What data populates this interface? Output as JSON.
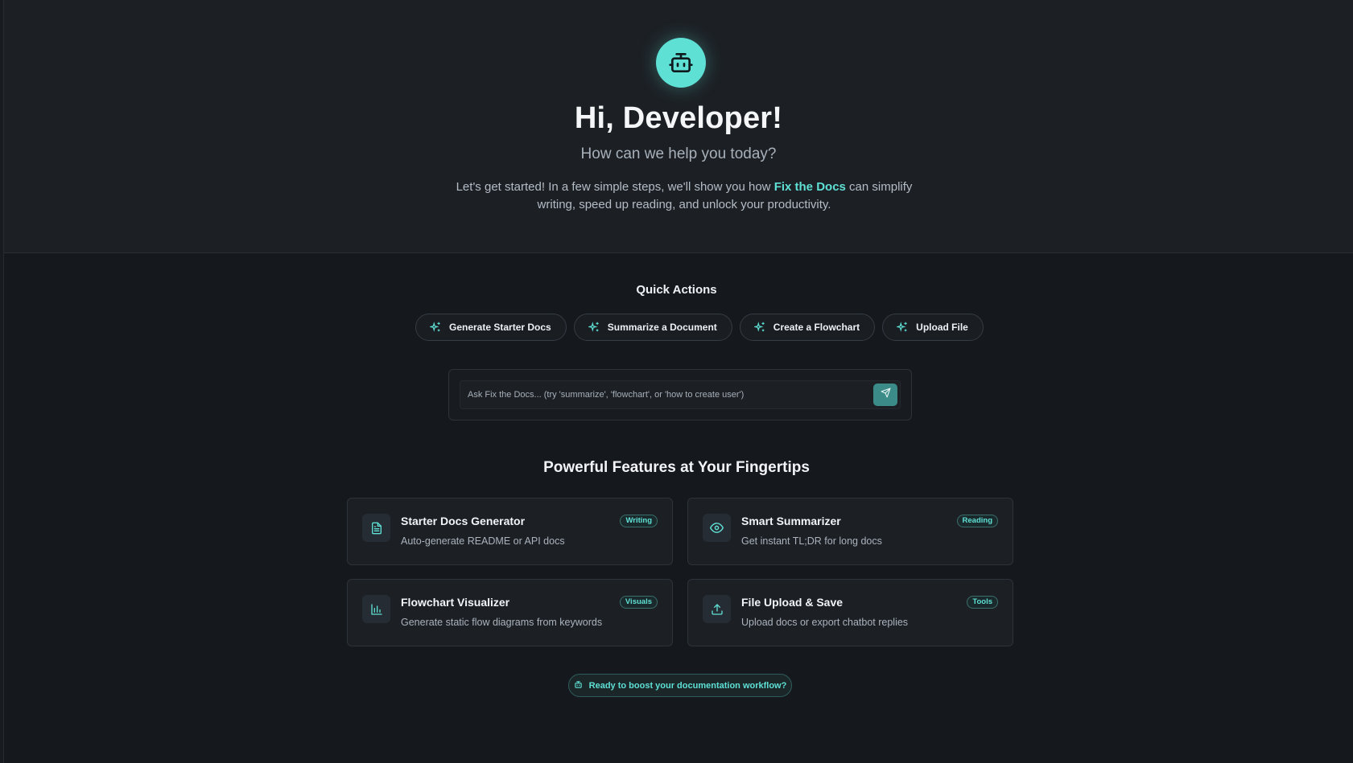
{
  "hero": {
    "title": "Hi, Developer!",
    "subtitle": "How can we help you today?",
    "description_before": "Let's get started! In a few simple steps, we'll show you how ",
    "brand": "Fix the Docs",
    "description_after": " can simplify writing, speed up reading, and unlock your productivity."
  },
  "quick_actions": {
    "title": "Quick Actions",
    "items": [
      {
        "label": "Generate Starter Docs",
        "icon": "sparkle-icon"
      },
      {
        "label": "Summarize a Document",
        "icon": "sparkle-icon"
      },
      {
        "label": "Create a Flowchart",
        "icon": "sparkle-icon"
      },
      {
        "label": "Upload File",
        "icon": "sparkle-icon"
      }
    ]
  },
  "ask": {
    "placeholder": "Ask Fix the Docs... (try 'summarize', 'flowchart', or 'how to create user')",
    "value": ""
  },
  "features": {
    "title": "Powerful Features at Your Fingertips",
    "items": [
      {
        "title": "Starter Docs Generator",
        "description": "Auto-generate README or API docs",
        "badge": "Writing",
        "icon": "document-icon"
      },
      {
        "title": "Smart Summarizer",
        "description": "Get instant TL;DR for long docs",
        "badge": "Reading",
        "icon": "eye-icon"
      },
      {
        "title": "Flowchart Visualizer",
        "description": "Generate static flow diagrams from keywords",
        "badge": "Visuals",
        "icon": "bar-chart-icon"
      },
      {
        "title": "File Upload & Save",
        "description": "Upload docs or export chatbot replies",
        "badge": "Tools",
        "icon": "upload-icon"
      }
    ]
  },
  "cta": {
    "label": "Ready to boost your documentation workflow?"
  },
  "colors": {
    "accent": "#5fe0d5",
    "background": "#15181d",
    "hero_background": "#1c2025",
    "send_button": "#3b8c88"
  }
}
